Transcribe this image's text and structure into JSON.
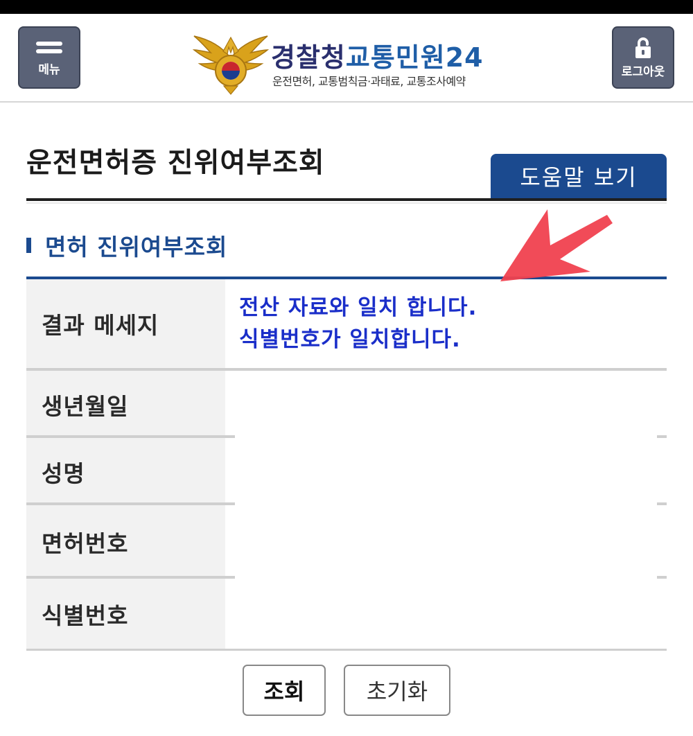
{
  "header": {
    "menu_label": "메뉴",
    "logout_label": "로그아웃",
    "brand_main": "경찰청",
    "brand_sub": "교통민원24",
    "tagline": "운전면허, 교통범칙금·과태료, 교통조사예약",
    "menu_icon": "hamburger-icon",
    "logout_icon": "unlock-icon",
    "emblem_icon": "police-eagle-emblem"
  },
  "page": {
    "title": "운전면허증 진위여부조회",
    "help_button": "도움말 보기"
  },
  "section": {
    "title": "면허 진위여부조회"
  },
  "table": {
    "rows": [
      {
        "label": "결과 메세지",
        "value_lines": [
          "전산 자료와 일치 합니다.",
          "식별번호가 일치합니다."
        ]
      },
      {
        "label": "생년월일",
        "value": ""
      },
      {
        "label": "성명",
        "value": ""
      },
      {
        "label": "면허번호",
        "value": ""
      },
      {
        "label": "식별번호",
        "value": ""
      }
    ]
  },
  "buttons": {
    "search": "조회",
    "reset": "초기화"
  },
  "colors": {
    "primary": "#1b4a8f",
    "message": "#1a2ec9",
    "arrow": "#f0414f",
    "header_button": "#5a6277"
  }
}
